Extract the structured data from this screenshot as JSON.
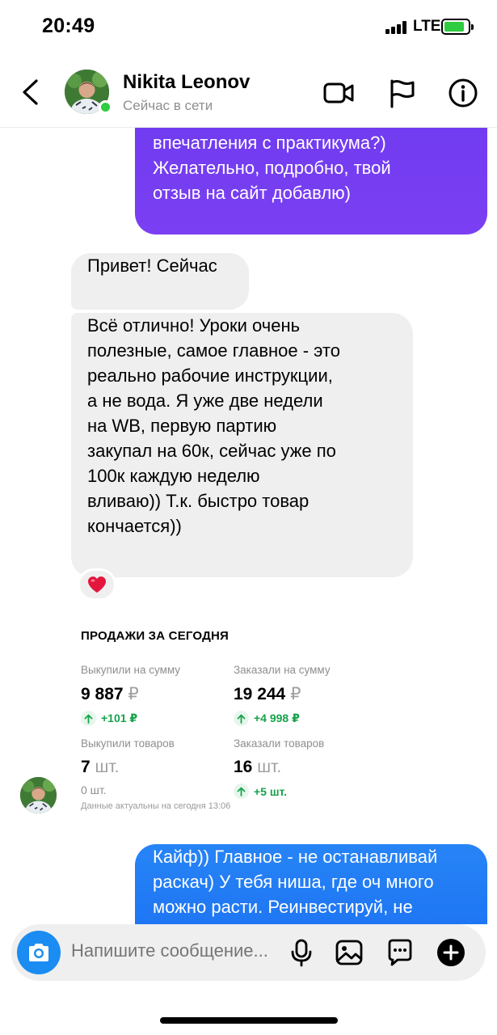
{
  "status_bar": {
    "time": "20:49",
    "network": "LTE"
  },
  "header": {
    "contact_name": "Nikita Leonov",
    "contact_status": "Сейчас в сети"
  },
  "messages": {
    "outgoing_1": "Привет) Расскажешь про свои\nвпечатления с практикума?)\nЖелательно, подробно, твой\nотзыв на сайт добавлю)",
    "incoming_1": "Привет! Сейчас",
    "incoming_2": "Всё отлично! Уроки очень\nполезные, самое главное - это\nреально рабочие инструкции,\nа не вода. Я уже две недели\nна WB, первую партию\nзакупал на 60к, сейчас уже по\n100к каждую неделю\nвливаю)) Т.к. быстро товар\nкончается))",
    "reaction": "❤️",
    "outgoing_2": "Кайф)) Главное - не останавливай\nраскач) У тебя ниша, где оч много\nможно расти. Реинвестируй, не"
  },
  "sales": {
    "title": "ПРОДАЖИ ЗА СЕГОДНЯ",
    "bought_sum_label": "Выкупили на сумму",
    "bought_sum_value": "9 887",
    "bought_sum_unit": "₽",
    "bought_sum_delta": "+101 ₽",
    "ordered_sum_label": "Заказали на сумму",
    "ordered_sum_value": "19 244",
    "ordered_sum_unit": "₽",
    "ordered_sum_delta": "+4 998 ₽",
    "bought_items_label": "Выкупили товаров",
    "bought_items_value": "7",
    "bought_items_unit": "шт.",
    "bought_items_delta": "0 шт.",
    "ordered_items_label": "Заказали товаров",
    "ordered_items_value": "16",
    "ordered_items_unit": "шт.",
    "ordered_items_delta": "+5 шт.",
    "note": "Данные актуальны на сегодня 13:06"
  },
  "composer": {
    "placeholder": "Напишите сообщение..."
  },
  "colors": {
    "outgoing_purple": "#7b3ff2",
    "outgoing_blue": "#1a6ff2",
    "incoming_gray": "#efefef",
    "online_green": "#2ecc40",
    "delta_green": "#16a34a",
    "camera_blue": "#1a8cf2"
  },
  "icons": [
    "chevron-left-icon",
    "video-camera-icon",
    "flag-icon",
    "info-icon",
    "heart-icon",
    "camera-icon",
    "microphone-icon",
    "image-icon",
    "chat-bubble-icon",
    "plus-circle-icon",
    "arrow-up-icon"
  ]
}
